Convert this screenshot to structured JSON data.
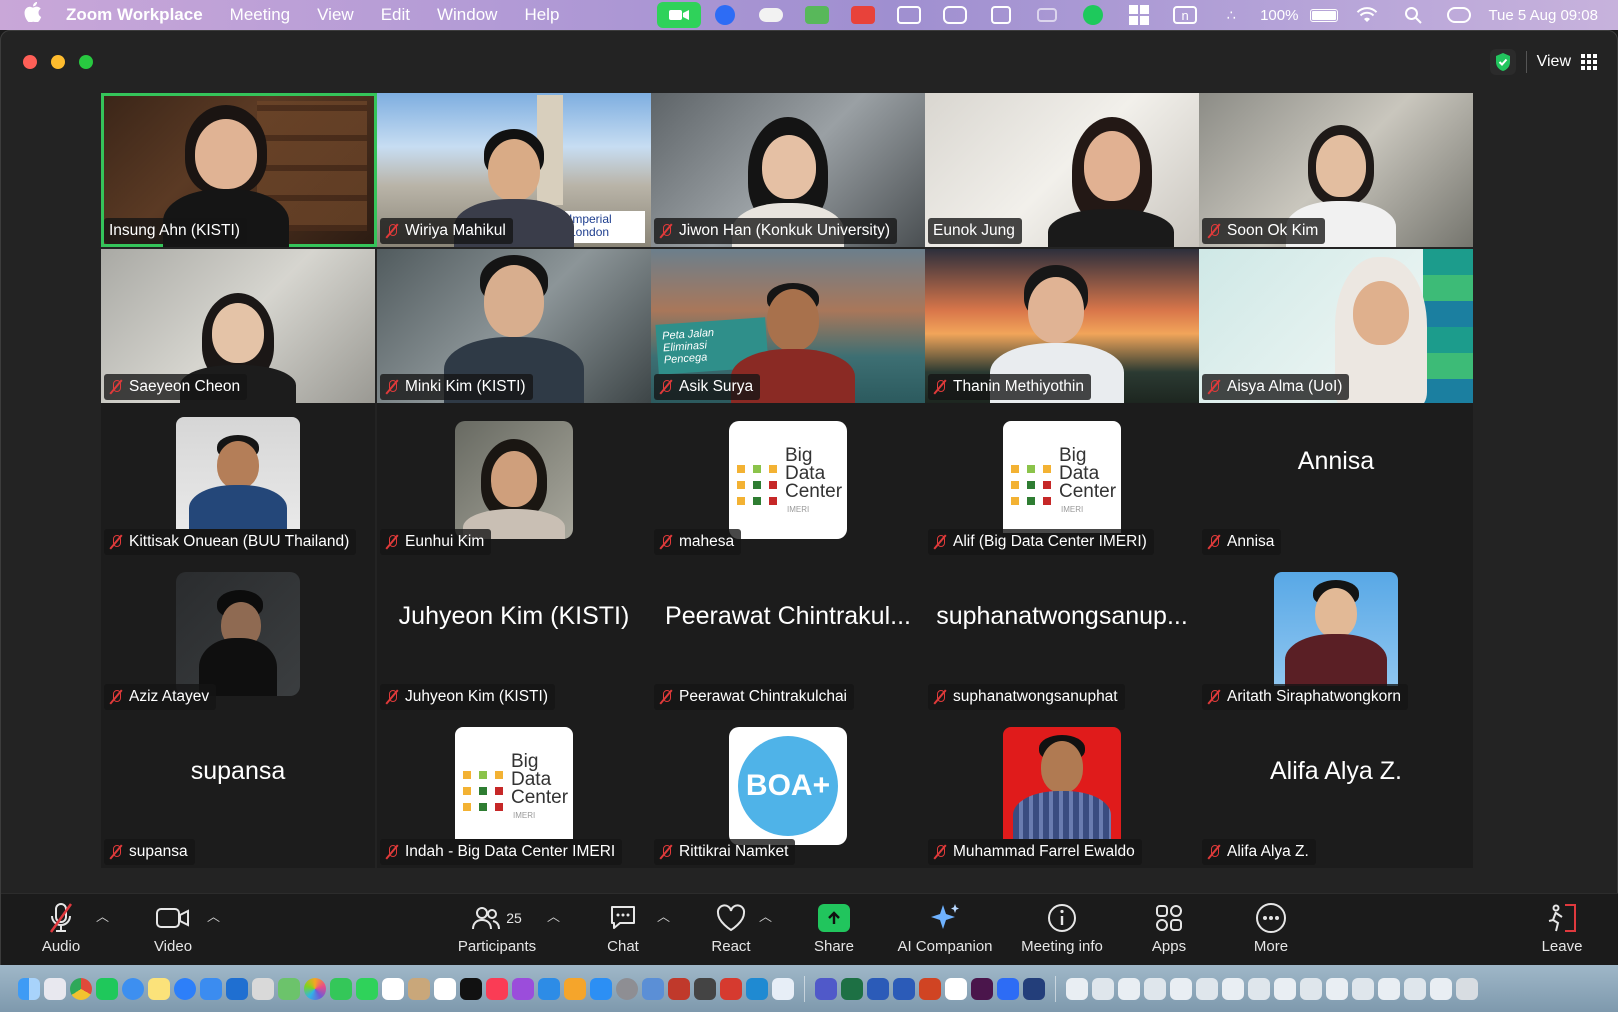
{
  "menubar": {
    "app_name": "Zoom Workplace",
    "menus": [
      "Meeting",
      "View",
      "Edit",
      "Window",
      "Help"
    ],
    "battery": "100%",
    "clock": "Tue 5 Aug  09:08"
  },
  "window": {
    "view_label": "View"
  },
  "participants": [
    {
      "name": "Insung Ahn (KISTI)",
      "muted": false,
      "active": true
    },
    {
      "name": "Wiriya Mahikul",
      "muted": true
    },
    {
      "name": "Jiwon Han (Konkuk University)",
      "muted": true
    },
    {
      "name": "Eunok Jung",
      "muted": false
    },
    {
      "name": "Soon Ok Kim",
      "muted": true
    },
    {
      "name": "Saeyeon Cheon",
      "muted": true
    },
    {
      "name": "Minki Kim (KISTI)",
      "muted": true
    },
    {
      "name": "Asik Surya",
      "muted": true
    },
    {
      "name": "Thanin Methiyothin",
      "muted": true
    },
    {
      "name": "Aisya Alma (UoI)",
      "muted": true
    },
    {
      "name": "Kittisak Onuean (BUU Thailand)",
      "muted": true
    },
    {
      "name": "Eunhui Kim",
      "muted": true
    },
    {
      "name": "mahesa",
      "muted": true
    },
    {
      "name": "Alif (Big Data Center IMERI)",
      "muted": true
    },
    {
      "name": "Annisa",
      "muted": true,
      "display": "Annisa"
    },
    {
      "name": "Aziz Atayev",
      "muted": true
    },
    {
      "name": "Juhyeon Kim (KISTI)",
      "muted": true,
      "display": "Juhyeon Kim (KISTI)"
    },
    {
      "name": "Peerawat Chintrakulchai",
      "muted": true,
      "display": "Peerawat Chintrakul..."
    },
    {
      "name": "suphanatwongsanuphat",
      "muted": true,
      "display": "suphanatwongsanup..."
    },
    {
      "name": "Aritath Siraphatwongkorn",
      "muted": true
    },
    {
      "name": "supansa",
      "muted": true,
      "display": "supansa"
    },
    {
      "name": "Indah - Big Data Center IMERI",
      "muted": true
    },
    {
      "name": "Rittikrai Namket",
      "muted": true
    },
    {
      "name": "Muhammad Farrel Ewaldo",
      "muted": true
    },
    {
      "name": "Alifa Alya Z.",
      "muted": true,
      "display": "Alifa Alya Z."
    }
  ],
  "bdc_logo": {
    "line1": "Big",
    "line2": "Data",
    "line3": "Center",
    "sub": "IMERI"
  },
  "boa_logo": {
    "text": "BOA+"
  },
  "video_overlays": {
    "imperial": "Imperial",
    "imperial2": "London",
    "peta": "Peta Jalan",
    "peta2": "Eliminasi",
    "peta3": "Pencega"
  },
  "toolbar": {
    "audio": "Audio",
    "video": "Video",
    "participants": "Participants",
    "participants_count": "25",
    "chat": "Chat",
    "react": "React",
    "share": "Share",
    "ai_companion": "AI Companion",
    "meeting_info": "Meeting info",
    "apps": "Apps",
    "more": "More",
    "leave": "Leave"
  },
  "colors": {
    "active_speaker": "#35c45a",
    "mute_red": "#e03a3a",
    "share_green": "#21c55d",
    "leave_red": "#e0393e"
  }
}
